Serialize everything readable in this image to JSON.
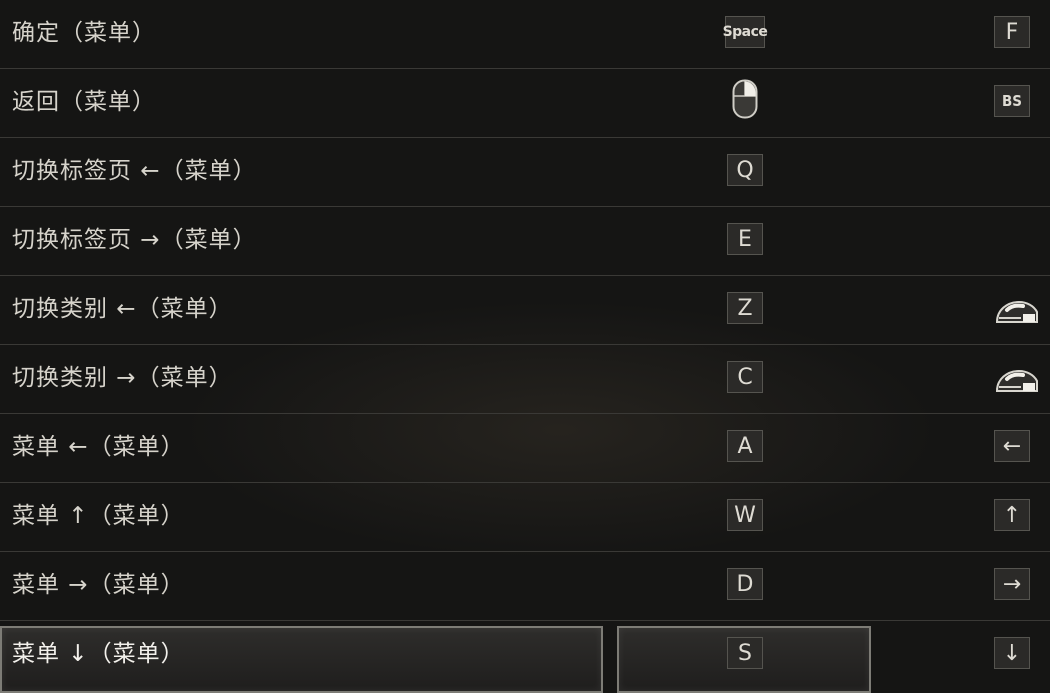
{
  "rows": [
    {
      "label": "确定（菜单）",
      "primary": "Space",
      "secondary": "F"
    },
    {
      "label": "返回（菜单）",
      "primary_icon": "mouse-right-click-icon",
      "secondary": "BS"
    },
    {
      "label": "切换标签页 ←（菜单）",
      "primary": "Q",
      "secondary": ""
    },
    {
      "label": "切换标签页 →（菜单）",
      "primary": "E",
      "secondary": ""
    },
    {
      "label": "切换类别 ←（菜单）",
      "primary": "Z",
      "secondary_icon": "mouse-wheel-icon"
    },
    {
      "label": "切换类别 →（菜单）",
      "primary": "C",
      "secondary_icon": "mouse-wheel-icon"
    },
    {
      "label": "菜单 ←（菜单）",
      "primary": "A",
      "secondary": "←"
    },
    {
      "label": "菜单 ↑（菜单）",
      "primary": "W",
      "secondary": "↑"
    },
    {
      "label": "菜单 →（菜单）",
      "primary": "D",
      "secondary": "→"
    },
    {
      "label": "菜单 ↓（菜单）",
      "primary": "S",
      "secondary": "↓"
    }
  ],
  "selected_index": 9
}
